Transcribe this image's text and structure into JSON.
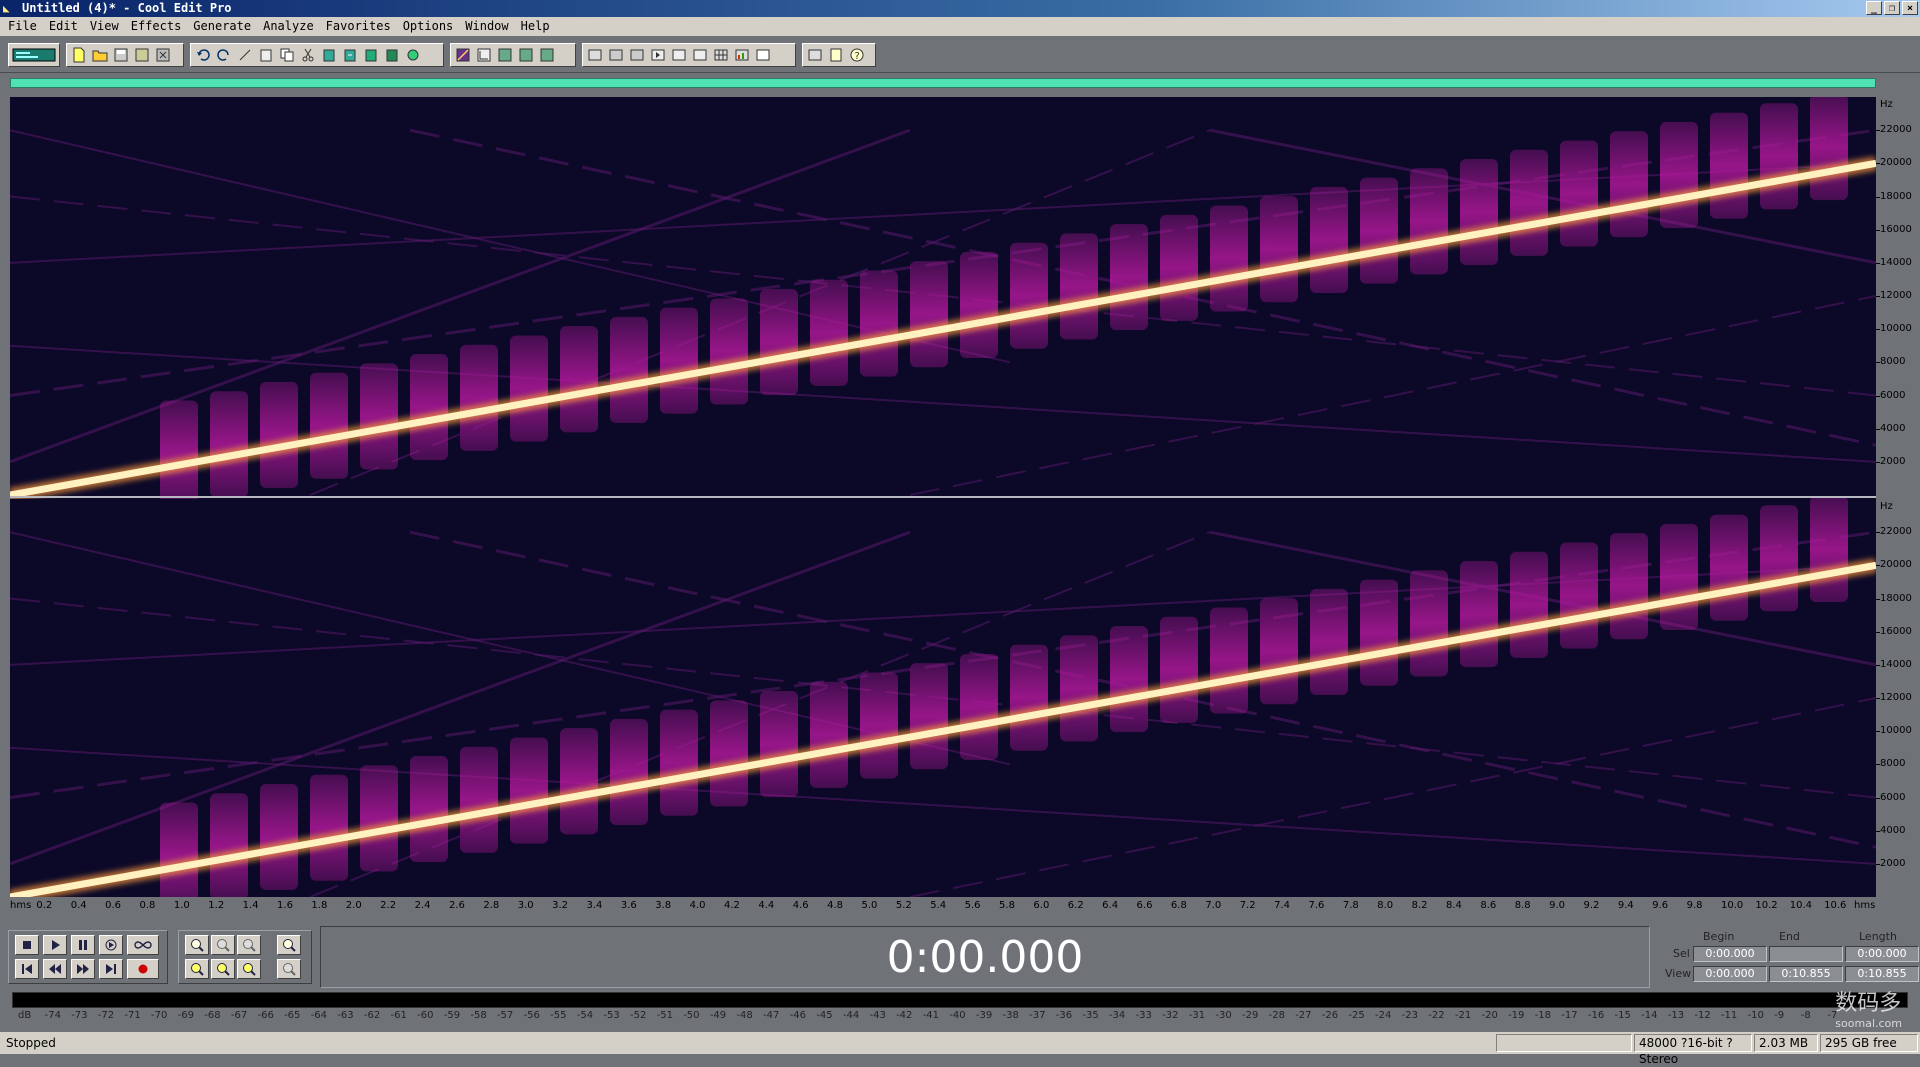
{
  "window": {
    "title": "Untitled (4)* - Cool Edit Pro",
    "buttons": [
      "_",
      "❐",
      "×"
    ]
  },
  "menu": [
    "File",
    "Edit",
    "View",
    "Effects",
    "Generate",
    "Analyze",
    "Favorites",
    "Options",
    "Window",
    "Help"
  ],
  "spectrogram": {
    "hz_unit": "Hz",
    "hz_labels": [
      "22000",
      "20000",
      "18000",
      "16000",
      "14000",
      "12000",
      "10000",
      "8000",
      "6000",
      "4000",
      "2000"
    ],
    "sweep_start_hz": 0,
    "sweep_end_hz": 20000,
    "max_hz": 24000
  },
  "timeline": {
    "unit_left": "hms",
    "unit_right": "hms",
    "labels": [
      "0.2",
      "0.4",
      "0.6",
      "0.8",
      "1.0",
      "1.2",
      "1.4",
      "1.6",
      "1.8",
      "2.0",
      "2.2",
      "2.4",
      "2.6",
      "2.8",
      "3.0",
      "3.2",
      "3.4",
      "3.6",
      "3.8",
      "4.0",
      "4.2",
      "4.4",
      "4.6",
      "4.8",
      "5.0",
      "5.2",
      "5.4",
      "5.6",
      "5.8",
      "6.0",
      "6.2",
      "6.4",
      "6.6",
      "6.8",
      "7.0",
      "7.2",
      "7.4",
      "7.6",
      "7.8",
      "8.0",
      "8.2",
      "8.4",
      "8.6",
      "8.8",
      "9.0",
      "9.2",
      "9.4",
      "9.6",
      "9.8",
      "10.0",
      "10.2",
      "10.4",
      "10.6"
    ],
    "duration": 10.855
  },
  "time_display": "0:00.000",
  "selection": {
    "headers": [
      "Begin",
      "End",
      "Length"
    ],
    "sel_label": "Sel",
    "view_label": "View",
    "sel": [
      "0:00.000",
      "",
      "0:00.000"
    ],
    "view": [
      "0:00.000",
      "0:10.855",
      "0:10.855"
    ]
  },
  "meter_labels": [
    "dB",
    "-74",
    "-73",
    "-72",
    "-71",
    "-70",
    "-69",
    "-68",
    "-67",
    "-66",
    "-65",
    "-64",
    "-63",
    "-62",
    "-61",
    "-60",
    "-59",
    "-58",
    "-57",
    "-56",
    "-55",
    "-54",
    "-53",
    "-52",
    "-51",
    "-50",
    "-49",
    "-48",
    "-47",
    "-46",
    "-45",
    "-44",
    "-43",
    "-42",
    "-41",
    "-40",
    "-39",
    "-38",
    "-37",
    "-36",
    "-35",
    "-34",
    "-33",
    "-32",
    "-31",
    "-30",
    "-29",
    "-28",
    "-27",
    "-26",
    "-25",
    "-24",
    "-23",
    "-22",
    "-21",
    "-20",
    "-19",
    "-18",
    "-17",
    "-16",
    "-15",
    "-14",
    "-13",
    "-12",
    "-11",
    "-10",
    "-9",
    "-8",
    "-7"
  ],
  "status": {
    "state": "Stopped",
    "format": "48000 ?16-bit ?Stereo",
    "size": "2.03 MB",
    "free": "295 GB free"
  },
  "watermark": {
    "text": "数码多",
    "url": "soomal.com"
  },
  "colors": {
    "overview": "#4fe3b4",
    "spectro_bg": "#0b0828",
    "sweep": "#fff2c0",
    "blob": "#b0189a"
  }
}
